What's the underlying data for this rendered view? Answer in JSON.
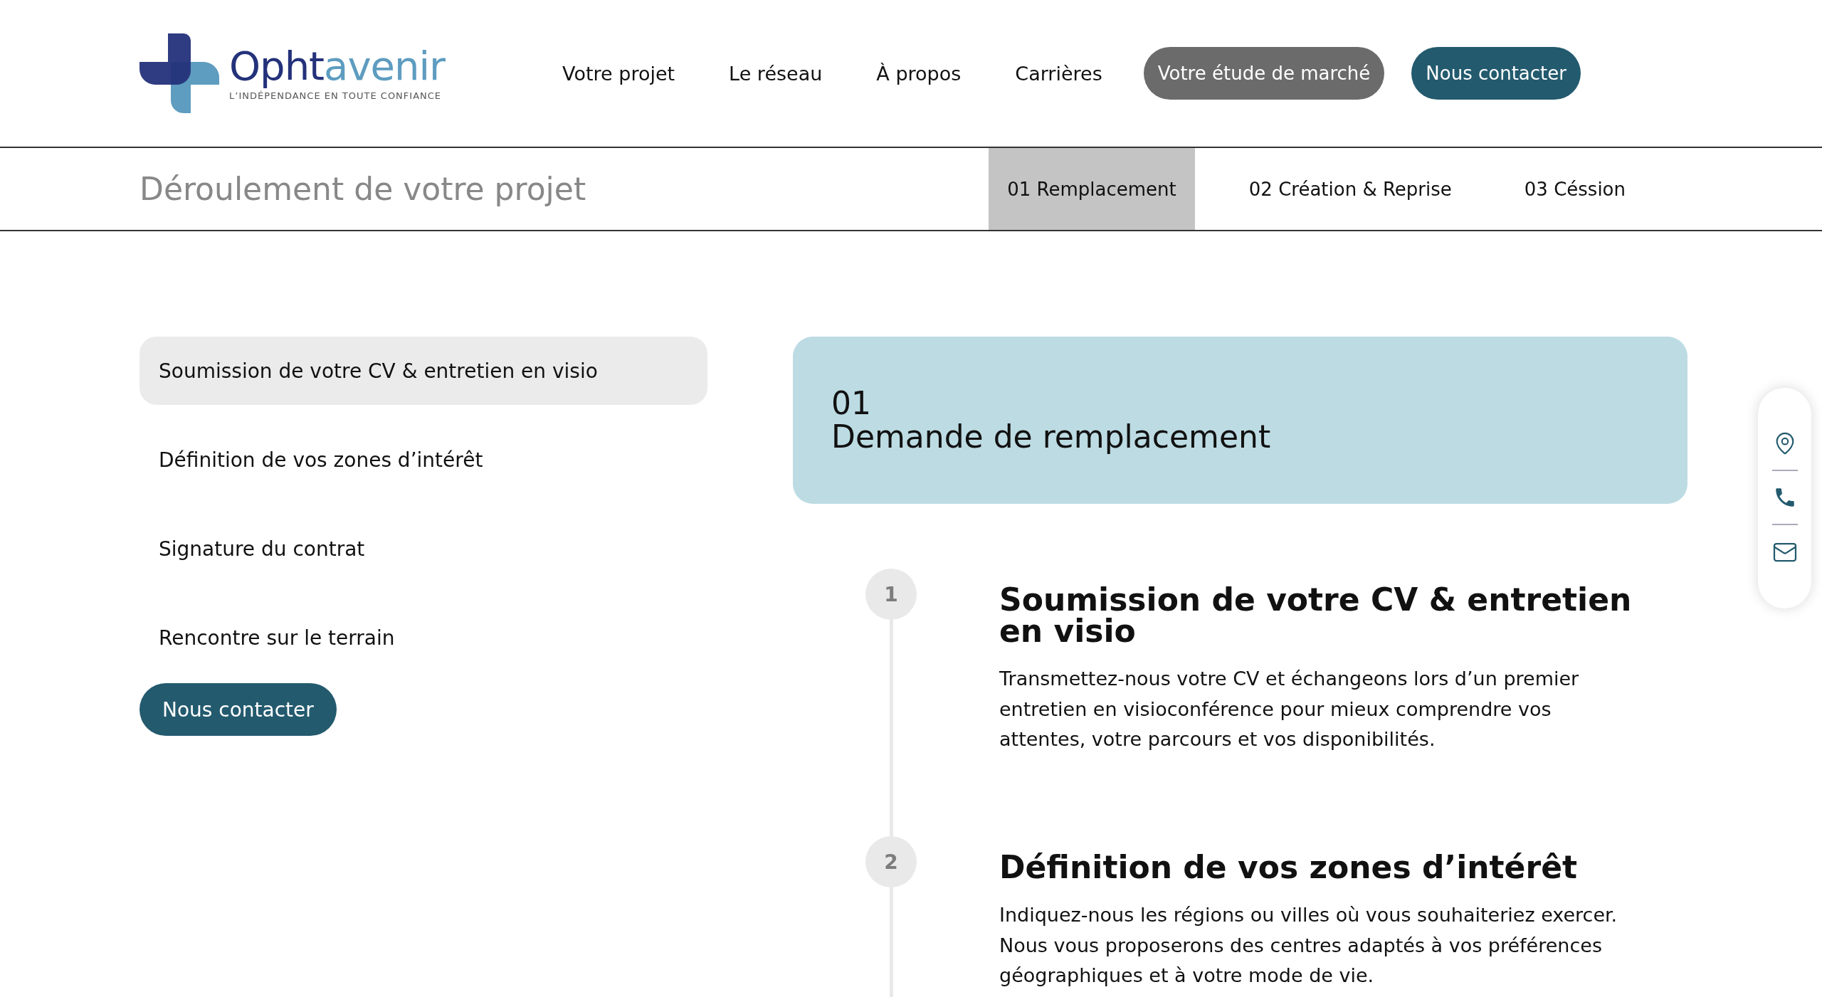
{
  "logo": {
    "name_dark": "Opht",
    "name_light": "avenir",
    "tagline": "L’INDÉPENDANCE EN TOUTE CONFIANCE"
  },
  "nav": {
    "links": [
      "Votre projet",
      "Le réseau",
      "À propos",
      "Carrières"
    ],
    "buttons": [
      {
        "label": "Votre étude de marché",
        "kind": "grey"
      },
      {
        "label": "Nous contacter",
        "kind": "teal"
      }
    ]
  },
  "subnav": {
    "title": "Déroulement de votre projet",
    "tabs": [
      {
        "label": "01 Remplacement",
        "selected": true
      },
      {
        "label": "02 Création & Reprise",
        "selected": false
      },
      {
        "label": "03 Céssion",
        "selected": false
      }
    ]
  },
  "steps_menu": {
    "items": [
      {
        "label": "Soumission de votre CV & entretien en visio",
        "selected": true
      },
      {
        "label": "Définition de vos zones d’intérêt",
        "selected": false
      },
      {
        "label": "Signature du contrat",
        "selected": false
      },
      {
        "label": "Rencontre sur le terrain",
        "selected": false
      }
    ],
    "button": "Nous contacter"
  },
  "phase_card": {
    "number": "01",
    "title": "Demande de remplacement"
  },
  "timeline": [
    {
      "number": "1",
      "title": "Soumission de votre CV & entretien en visio",
      "text": "Transmettez-nous votre CV et échangeons lors d’un premier entretien en visioconférence pour mieux comprendre vos attentes, votre parcours et vos disponibilités."
    },
    {
      "number": "2",
      "title": "Définition de vos zones d’intérêt",
      "text": "Indiquez-nous les régions ou villes où vous souhaiteriez exercer. Nous vous proposerons des centres adaptés à vos préférences géographiques et à votre mode de vie."
    }
  ]
}
